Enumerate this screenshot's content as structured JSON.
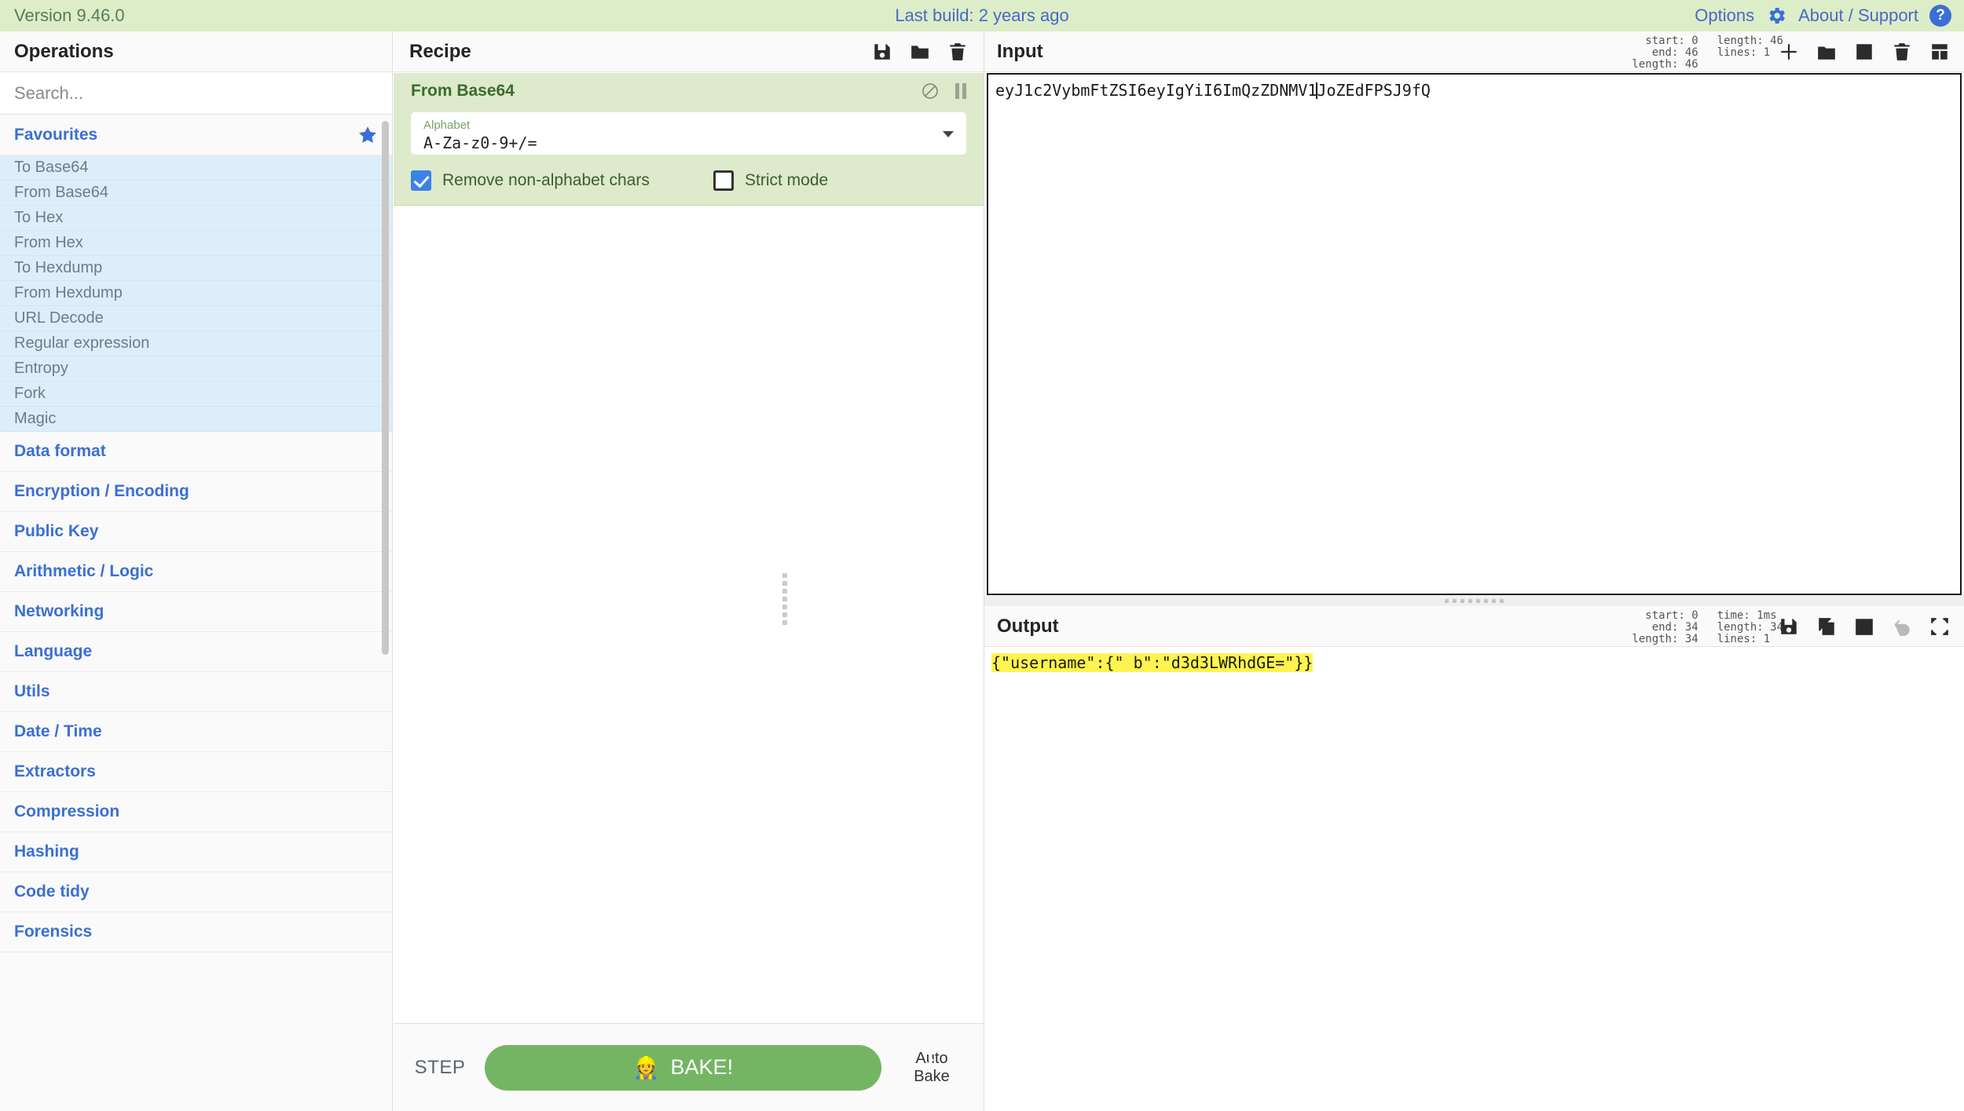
{
  "banner": {
    "version": "Version 9.46.0",
    "last_build": "Last build: 2 years ago",
    "options_label": "Options",
    "about_label": "About / Support",
    "accent_blue": "#3b6fd4",
    "background": "#dcedc8"
  },
  "operations": {
    "title": "Operations",
    "search_placeholder": "Search...",
    "search_value": "",
    "favourites_label": "Favourites",
    "favourites": [
      "To Base64",
      "From Base64",
      "To Hex",
      "From Hex",
      "To Hexdump",
      "From Hexdump",
      "URL Decode",
      "Regular expression",
      "Entropy",
      "Fork",
      "Magic"
    ],
    "categories": [
      "Data format",
      "Encryption / Encoding",
      "Public Key",
      "Arithmetic / Logic",
      "Networking",
      "Language",
      "Utils",
      "Date / Time",
      "Extractors",
      "Compression",
      "Hashing",
      "Code tidy",
      "Forensics"
    ]
  },
  "recipe": {
    "title": "Recipe",
    "header_icons": [
      "save-icon",
      "folder-icon",
      "trash-icon"
    ],
    "operation": {
      "name": "From Base64",
      "disable_icon": "disable-icon",
      "pause_icon": "breakpoint-icon",
      "arg_label": "Alphabet",
      "arg_value": "A-Za-z0-9+/=",
      "checkbox_1_label": "Remove non-alphabet chars",
      "checkbox_1_checked": true,
      "checkbox_2_label": "Strict mode",
      "checkbox_2_checked": false
    },
    "controls": {
      "step_label": "STEP",
      "bake_label": "BAKE!",
      "bake_icon": "chef-icon",
      "bake_color": "#74b563",
      "auto_bake_label": "Auto Bake",
      "auto_bake_checked": true
    }
  },
  "input": {
    "title": "Input",
    "value": "eyJ1c2VybmFtZSI6eyIgYiI6ImQzZDNMV1",
    "value_after_cursor": "JoZEdFPSJ9fQ",
    "meta_left": [
      "start:  0",
      "end: 46",
      "length: 46"
    ],
    "meta_right": [
      "length: 46",
      "lines:  1"
    ],
    "icons": [
      "add-tab-icon",
      "open-file-icon",
      "open-folder-icon",
      "clear-io-icon",
      "reset-layout-icon"
    ]
  },
  "output": {
    "title": "Output",
    "value": "{\"username\":{\" b\":\"d3d3LWRhdGE=\"}}",
    "highlight_color": "#fff44f",
    "meta_left": [
      "start:  0",
      "end: 34",
      "length: 34"
    ],
    "meta_right": [
      "time: 1ms",
      "length: 34",
      "lines:    1"
    ],
    "icons": [
      "save-output-icon",
      "copy-output-icon",
      "replace-input-icon",
      "undo-icon",
      "maximise-icon"
    ]
  }
}
